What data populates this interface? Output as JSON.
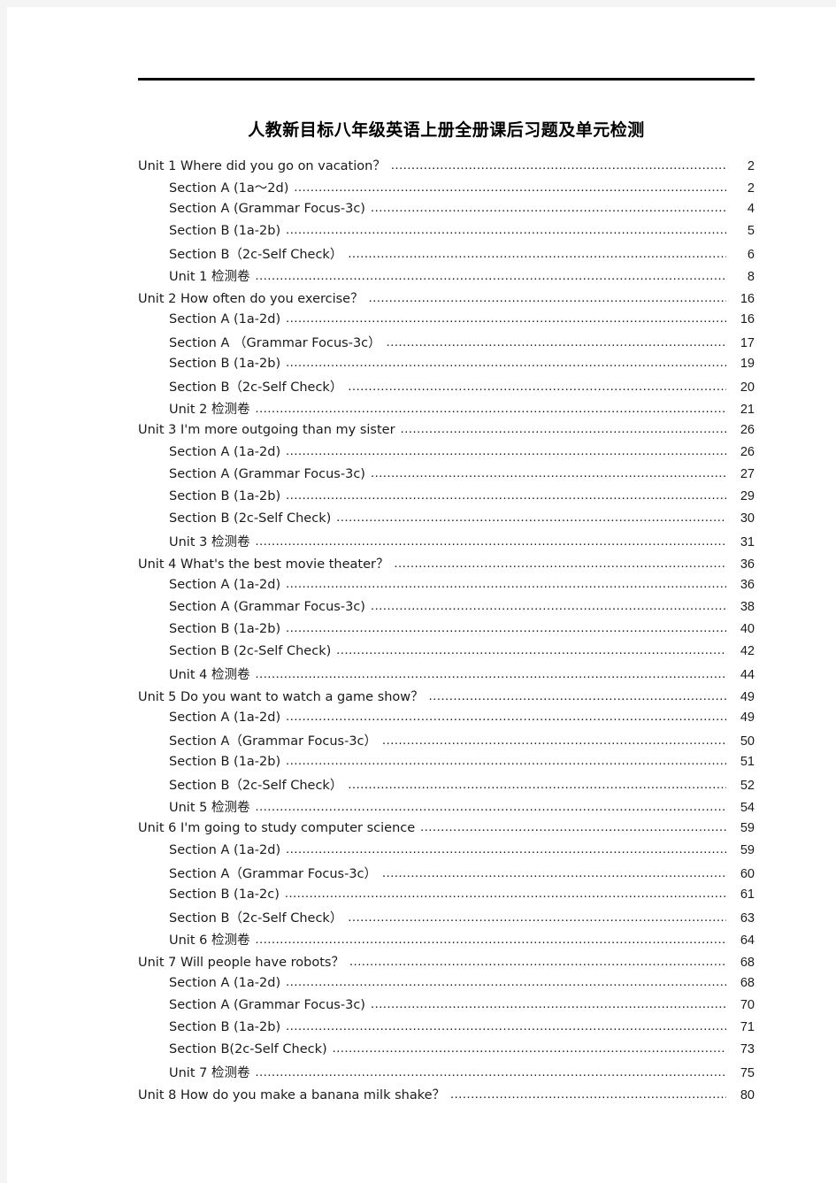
{
  "document": {
    "title": "人教新目标八年级英语上册全册课后习题及单元检测",
    "text_color": "#1a1a1a",
    "page_background": "#ffffff",
    "canvas_background": "#f4f4f4",
    "rule_color": "#000000"
  },
  "toc": {
    "entries": [
      {
        "level": 1,
        "label": "Unit 1 Where did you go on vacation？",
        "page": "2"
      },
      {
        "level": 2,
        "label": "Section A (1a～2d)",
        "page": "2"
      },
      {
        "level": 2,
        "label": "Section A (Grammar Focus-3c)",
        "page": "4"
      },
      {
        "level": 2,
        "label": "Section B (1a-2b)",
        "page": "5"
      },
      {
        "level": 2,
        "label": "Section B（2c-Self Check）",
        "page": "6"
      },
      {
        "level": 2,
        "label": "Unit 1 检测卷",
        "page": "8"
      },
      {
        "level": 1,
        "label": "Unit 2 How often do you exercise？",
        "page": "16"
      },
      {
        "level": 2,
        "label": "Section A (1a-2d)",
        "page": "16"
      },
      {
        "level": 2,
        "label": "Section A （Grammar Focus-3c）",
        "page": "17"
      },
      {
        "level": 2,
        "label": "Section B (1a-2b)",
        "page": "19"
      },
      {
        "level": 2,
        "label": "Section B（2c-Self Check）",
        "page": "20"
      },
      {
        "level": 2,
        "label": "Unit 2 检测卷",
        "page": "21"
      },
      {
        "level": 1,
        "label": "Unit 3 I'm more outgoing than my sister",
        "page": "26"
      },
      {
        "level": 2,
        "label": "Section A (1a-2d)",
        "page": "26"
      },
      {
        "level": 2,
        "label": "Section A (Grammar Focus-3c)",
        "page": "27"
      },
      {
        "level": 2,
        "label": "Section B (1a-2b)",
        "page": "29"
      },
      {
        "level": 2,
        "label": "Section B (2c-Self Check)",
        "page": "30"
      },
      {
        "level": 2,
        "label": "Unit 3 检测卷",
        "page": "31"
      },
      {
        "level": 1,
        "label": "Unit 4 What's the best movie theater？",
        "page": "36"
      },
      {
        "level": 2,
        "label": "Section A (1a-2d)",
        "page": "36"
      },
      {
        "level": 2,
        "label": "Section A (Grammar Focus-3c)",
        "page": "38"
      },
      {
        "level": 2,
        "label": "Section B (1a-2b)",
        "page": "40"
      },
      {
        "level": 2,
        "label": "Section B (2c-Self Check)",
        "page": "42"
      },
      {
        "level": 2,
        "label": "Unit 4 检测卷",
        "page": "44"
      },
      {
        "level": 1,
        "label": "Unit 5 Do you want to watch a game show？",
        "page": "49"
      },
      {
        "level": 2,
        "label": "Section A (1a-2d)",
        "page": "49"
      },
      {
        "level": 2,
        "label": "Section A（Grammar Focus-3c）",
        "page": "50"
      },
      {
        "level": 2,
        "label": "Section B (1a-2b)",
        "page": "51"
      },
      {
        "level": 2,
        "label": "Section B（2c-Self Check）",
        "page": "52"
      },
      {
        "level": 2,
        "label": "Unit 5 检测卷",
        "page": "54"
      },
      {
        "level": 1,
        "label": "Unit 6 I'm going to study computer science",
        "page": "59"
      },
      {
        "level": 2,
        "label": "Section A (1a-2d)",
        "page": "59"
      },
      {
        "level": 2,
        "label": "Section A（Grammar Focus-3c）",
        "page": "60"
      },
      {
        "level": 2,
        "label": "Section B (1a-2c)",
        "page": "61"
      },
      {
        "level": 2,
        "label": "Section B（2c-Self Check）",
        "page": "63"
      },
      {
        "level": 2,
        "label": "Unit 6 检测卷",
        "page": "64"
      },
      {
        "level": 1,
        "label": "Unit 7 Will people have robots？",
        "page": "68"
      },
      {
        "level": 2,
        "label": "Section A (1a-2d)",
        "page": "68"
      },
      {
        "level": 2,
        "label": "Section A (Grammar Focus-3c)",
        "page": "70"
      },
      {
        "level": 2,
        "label": "Section B (1a-2b)",
        "page": "71"
      },
      {
        "level": 2,
        "label": "Section B(2c-Self Check)",
        "page": "73"
      },
      {
        "level": 2,
        "label": "Unit 7 检测卷",
        "page": "75"
      },
      {
        "level": 1,
        "label": "Unit 8 How do you make a banana milk shake？",
        "page": "80"
      }
    ]
  }
}
